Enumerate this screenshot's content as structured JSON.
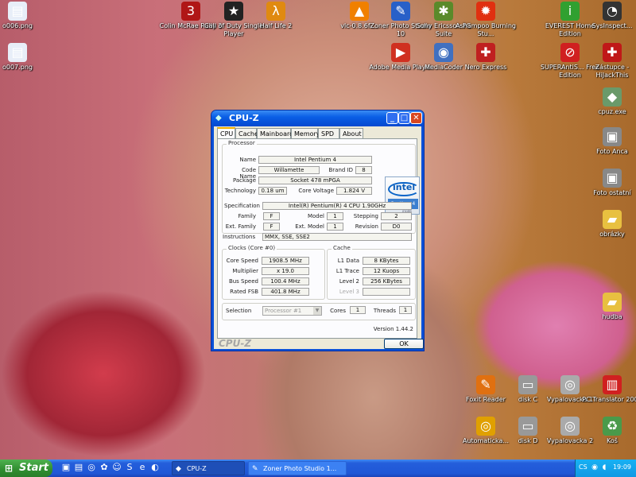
{
  "desktop": {
    "icons": [
      {
        "id": "o006",
        "label": "o006.png",
        "glyph": "▤",
        "color": "#e8eef8"
      },
      {
        "id": "o007",
        "label": "o007.png",
        "glyph": "▤",
        "color": "#e8eef8"
      },
      {
        "id": "colin",
        "label": "Colin McRae Rally 3",
        "glyph": "3",
        "color": "#b01616"
      },
      {
        "id": "cod",
        "label": "Call of Duty Single Player",
        "glyph": "★",
        "color": "#222222"
      },
      {
        "id": "hl2",
        "label": "Half Life 2",
        "glyph": "λ",
        "color": "#e08a10"
      },
      {
        "id": "vlc",
        "label": "vlc-0.8.6f-...",
        "glyph": "▲",
        "color": "#f08000"
      },
      {
        "id": "zoner",
        "label": "Zoner Photo Studio 10",
        "glyph": "✎",
        "color": "#2860c8"
      },
      {
        "id": "sony",
        "label": "Sony Ericsson PC Suite",
        "glyph": "✱",
        "color": "#5a8a2a"
      },
      {
        "id": "ashampoo",
        "label": "Ashampoo Burning Stu...",
        "glyph": "✹",
        "color": "#e03010"
      },
      {
        "id": "everest",
        "label": "EVEREST Home Edition",
        "glyph": "i",
        "color": "#30a030"
      },
      {
        "id": "sysinspect",
        "label": "SysInspect...",
        "glyph": "◔",
        "color": "#333333"
      },
      {
        "id": "adobe",
        "label": "Adobe Media Player",
        "glyph": "▶",
        "color": "#d03020"
      },
      {
        "id": "mediacoder",
        "label": "MediaCoder",
        "glyph": "◉",
        "color": "#4070c0"
      },
      {
        "id": "nero",
        "label": "Nero Express",
        "glyph": "✚",
        "color": "#c02020"
      },
      {
        "id": "superanti",
        "label": "SUPERAntiS... Free Edition",
        "glyph": "⊘",
        "color": "#d02020"
      },
      {
        "id": "zastupce",
        "label": "Zástupce - HiJackThis",
        "glyph": "✚",
        "color": "#c01818"
      },
      {
        "id": "cpuz",
        "label": "cpuz.exe",
        "glyph": "◆",
        "color": "#6a9a6a"
      },
      {
        "id": "foto-anca",
        "label": "Foto Anca",
        "glyph": "▣",
        "color": "#888888"
      },
      {
        "id": "foto-ostatni",
        "label": "Foto ostatní",
        "glyph": "▣",
        "color": "#888888"
      },
      {
        "id": "obrazky",
        "label": "obrázky",
        "glyph": "▰",
        "color": "#e8c040"
      },
      {
        "id": "hudba",
        "label": "hudba",
        "glyph": "▰",
        "color": "#e8c040"
      },
      {
        "id": "foxit",
        "label": "Foxit Reader",
        "glyph": "✎",
        "color": "#e07010"
      },
      {
        "id": "diskc",
        "label": "disk C",
        "glyph": "▭",
        "color": "#999999"
      },
      {
        "id": "vyp1",
        "label": "Vypalovacka 1",
        "glyph": "◎",
        "color": "#aaaaaa"
      },
      {
        "id": "pctrans",
        "label": "PC Translator 2007",
        "glyph": "▥",
        "color": "#d02020"
      },
      {
        "id": "automaticka",
        "label": "Automaticka...",
        "glyph": "◎",
        "color": "#e0a000"
      },
      {
        "id": "diskd",
        "label": "disk D",
        "glyph": "▭",
        "color": "#999999"
      },
      {
        "id": "vyp2",
        "label": "Vypalovacka 2",
        "glyph": "◎",
        "color": "#aaaaaa"
      },
      {
        "id": "kos",
        "label": "Koš",
        "glyph": "♻",
        "color": "#4a9a4a"
      }
    ]
  },
  "window": {
    "title": "CPU-Z",
    "tabs": [
      "CPU",
      "Cache",
      "Mainboard",
      "Memory",
      "SPD",
      "About"
    ],
    "active_tab": "CPU",
    "processor": {
      "group_title": "Processor",
      "name_label": "Name",
      "name": "Intel Pentium 4",
      "codename_label": "Code Name",
      "codename": "Willamette",
      "brandid_label": "Brand ID",
      "brandid": "8",
      "package_label": "Package",
      "package": "Socket 478 mPGA",
      "technology_label": "Technology",
      "technology": "0.18 um",
      "corevoltage_label": "Core Voltage",
      "corevoltage": "1.824 V",
      "spec_label": "Specification",
      "spec": "Intel(R) Pentium(R) 4 CPU 1.90GHz",
      "family_label": "Family",
      "family": "F",
      "model_label": "Model",
      "model": "1",
      "stepping_label": "Stepping",
      "stepping": "2",
      "extfamily_label": "Ext. Family",
      "extfamily": "F",
      "extmodel_label": "Ext. Model",
      "extmodel": "1",
      "revision_label": "Revision",
      "revision": "D0",
      "instructions_label": "Instructions",
      "instructions": "MMX, SSE, SSE2",
      "logo_brand": "intel",
      "logo_product": "Pentium 4",
      "logo_tag": "inside"
    },
    "clocks": {
      "group_title": "Clocks (Core #0)",
      "corespeed_label": "Core Speed",
      "corespeed": "1908.5 MHz",
      "multiplier_label": "Multiplier",
      "multiplier": "x 19.0",
      "busspeed_label": "Bus Speed",
      "busspeed": "100.4 MHz",
      "ratedfsb_label": "Rated FSB",
      "ratedfsb": "401.8 MHz"
    },
    "cache": {
      "group_title": "Cache",
      "l1data_label": "L1 Data",
      "l1data": "8 KBytes",
      "l1trace_label": "L1 Trace",
      "l1trace": "12 Kuops",
      "level2_label": "Level 2",
      "level2": "256 KBytes",
      "level3_label": "Level 3",
      "level3": ""
    },
    "selection": {
      "label": "Selection",
      "value": "Processor #1",
      "cores_label": "Cores",
      "cores": "1",
      "threads_label": "Threads",
      "threads": "1"
    },
    "version": "Version 1.44.2",
    "brand": "CPU-Z",
    "ok": "OK"
  },
  "taskbar": {
    "start": "Start",
    "tasks": [
      {
        "label": "CPU-Z",
        "active": true
      },
      {
        "label": "Zoner Photo Studio 1...",
        "active": false
      }
    ],
    "lang": "CS",
    "clock": "19:09"
  }
}
